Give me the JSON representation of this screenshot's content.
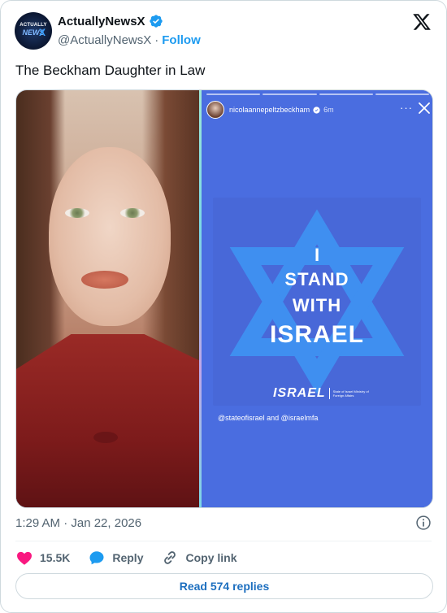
{
  "author": {
    "display_name": "ActuallyNewsX",
    "handle": "@ActuallyNewsX",
    "separator": "·",
    "follow_label": "Follow",
    "avatar_logo_top": "ACTUALLY",
    "avatar_logo_bottom": "NEWS",
    "avatar_logo_x": "X"
  },
  "tweet": {
    "text": "The Beckham Daughter in Law"
  },
  "story": {
    "username": "nicolaannepeltzbeckham",
    "time": "6m",
    "more": "···",
    "graphic": {
      "line1": "I",
      "line2": "STAND",
      "line3": "WITH",
      "line4": "ISRAEL",
      "brand_word": "ISRAEL",
      "brand_small": "State of Israel Ministry of Foreign Affairs"
    },
    "mentions": "@stateofisrael and @israelmfa",
    "progress_segments": 4
  },
  "meta": {
    "timestamp": "1:29 AM · Jan 22, 2026"
  },
  "actions": {
    "likes": "15.5K",
    "reply_label": "Reply",
    "copy_link_label": "Copy link"
  },
  "replies_button": "Read 574 replies",
  "colors": {
    "accent": "#1d9bf0",
    "like": "#f91880",
    "story_bg": "#4a6de0",
    "star": "#3f8ff0"
  }
}
